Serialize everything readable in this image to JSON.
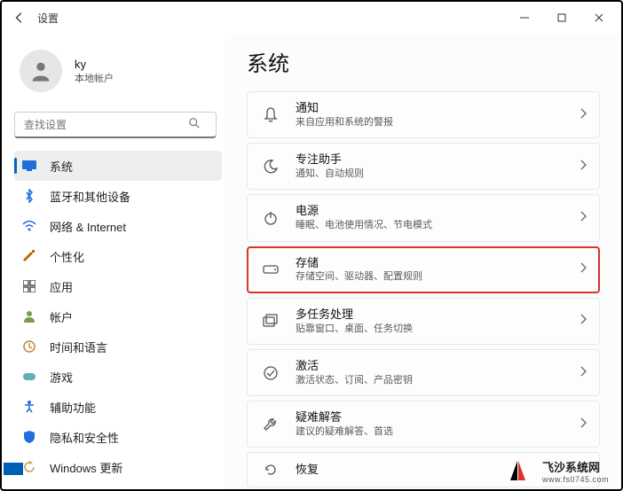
{
  "window": {
    "title": "设置",
    "controls": {
      "minimize": "—",
      "maximize": "□",
      "close": "✕"
    }
  },
  "profile": {
    "name": "ky",
    "subtitle": "本地帐户"
  },
  "search": {
    "placeholder": "查找设置"
  },
  "nav": [
    {
      "label": "系统",
      "icon": "system-icon",
      "color": "#1e6fd9",
      "active": true
    },
    {
      "label": "蓝牙和其他设备",
      "icon": "bluetooth-icon",
      "color": "#1e6fd9"
    },
    {
      "label": "网络 & Internet",
      "icon": "wifi-icon",
      "color": "#1e6fd9"
    },
    {
      "label": "个性化",
      "icon": "personalize-icon",
      "color": "#b36b00"
    },
    {
      "label": "应用",
      "icon": "apps-icon",
      "color": "#555"
    },
    {
      "label": "帐户",
      "icon": "account-icon",
      "color": "#7a9b4a"
    },
    {
      "label": "时间和语言",
      "icon": "time-icon",
      "color": "#c08a3c"
    },
    {
      "label": "游戏",
      "icon": "gaming-icon",
      "color": "#5fb0b7"
    },
    {
      "label": "辅助功能",
      "icon": "accessibility-icon",
      "color": "#1e6fd9"
    },
    {
      "label": "隐私和安全性",
      "icon": "privacy-icon",
      "color": "#1e6fd9"
    },
    {
      "label": "Windows 更新",
      "icon": "update-icon",
      "color": "#c7a04a"
    }
  ],
  "page": {
    "title": "系统"
  },
  "cards": [
    {
      "icon": "bell-icon",
      "title": "通知",
      "sub": "来自应用和系统的警报"
    },
    {
      "icon": "moon-icon",
      "title": "专注助手",
      "sub": "通知、自动规则"
    },
    {
      "icon": "power-icon",
      "title": "电源",
      "sub": "睡眠、电池使用情况、节电模式"
    },
    {
      "icon": "storage-icon",
      "title": "存储",
      "sub": "存储空间、驱动器、配置规则",
      "highlight": true
    },
    {
      "icon": "multitask-icon",
      "title": "多任务处理",
      "sub": "贴靠窗口、桌面、任务切换"
    },
    {
      "icon": "activation-icon",
      "title": "激活",
      "sub": "激活状态、订阅、产品密钥"
    },
    {
      "icon": "troubleshoot-icon",
      "title": "疑难解答",
      "sub": "建议的疑难解答、首选"
    },
    {
      "icon": "recovery-icon",
      "title": "恢复",
      "sub": ""
    }
  ],
  "watermark": {
    "name": "飞沙系统网",
    "url": "www.fs0745.com"
  }
}
